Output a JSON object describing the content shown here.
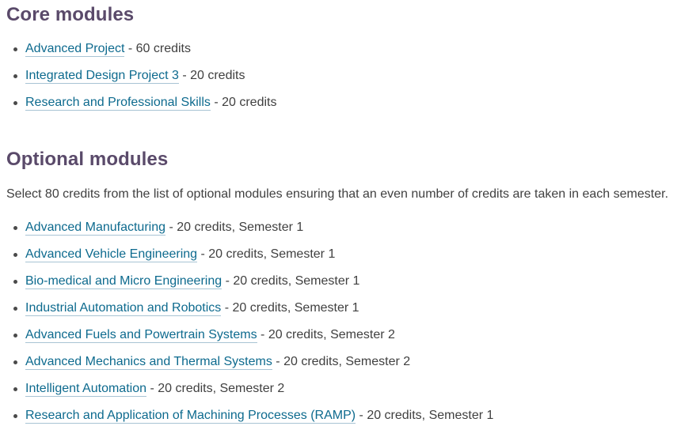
{
  "core_section": {
    "heading": "Core modules",
    "modules": [
      {
        "name": "Advanced Project",
        "detail": " - 60 credits"
      },
      {
        "name": "Integrated Design Project 3",
        "detail": " - 20 credits"
      },
      {
        "name": "Research and Professional Skills",
        "detail": " - 20 credits"
      }
    ]
  },
  "optional_section": {
    "heading": "Optional modules",
    "intro": "Select 80 credits from the list of optional modules ensuring that an even number of credits are taken in each semester.",
    "modules": [
      {
        "name": "Advanced Manufacturing",
        "detail": " - 20 credits, Semester 1"
      },
      {
        "name": "Advanced Vehicle Engineering",
        "detail": " - 20 credits, Semester 1"
      },
      {
        "name": "Bio-medical and Micro Engineering",
        "detail": " - 20 credits, Semester 1"
      },
      {
        "name": "Industrial Automation and Robotics",
        "detail": " - 20 credits, Semester 1"
      },
      {
        "name": "Advanced Fuels and Powertrain Systems",
        "detail": " - 20 credits, Semester 2"
      },
      {
        "name": "Advanced Mechanics and Thermal Systems",
        "detail": " - 20 credits, Semester 2"
      },
      {
        "name": "Intelligent Automation",
        "detail": " - 20 credits, Semester 2"
      },
      {
        "name": "Research and Application of Machining Processes (RAMP)",
        "detail": " - 20 credits, Semester 1"
      }
    ]
  },
  "colors": {
    "heading": "#5a4a6a",
    "link": "#0d6a8e",
    "link_underline": "#a8c4d4",
    "body_text": "#404040",
    "background": "#ffffff",
    "bullet": "#4a4a4a"
  }
}
